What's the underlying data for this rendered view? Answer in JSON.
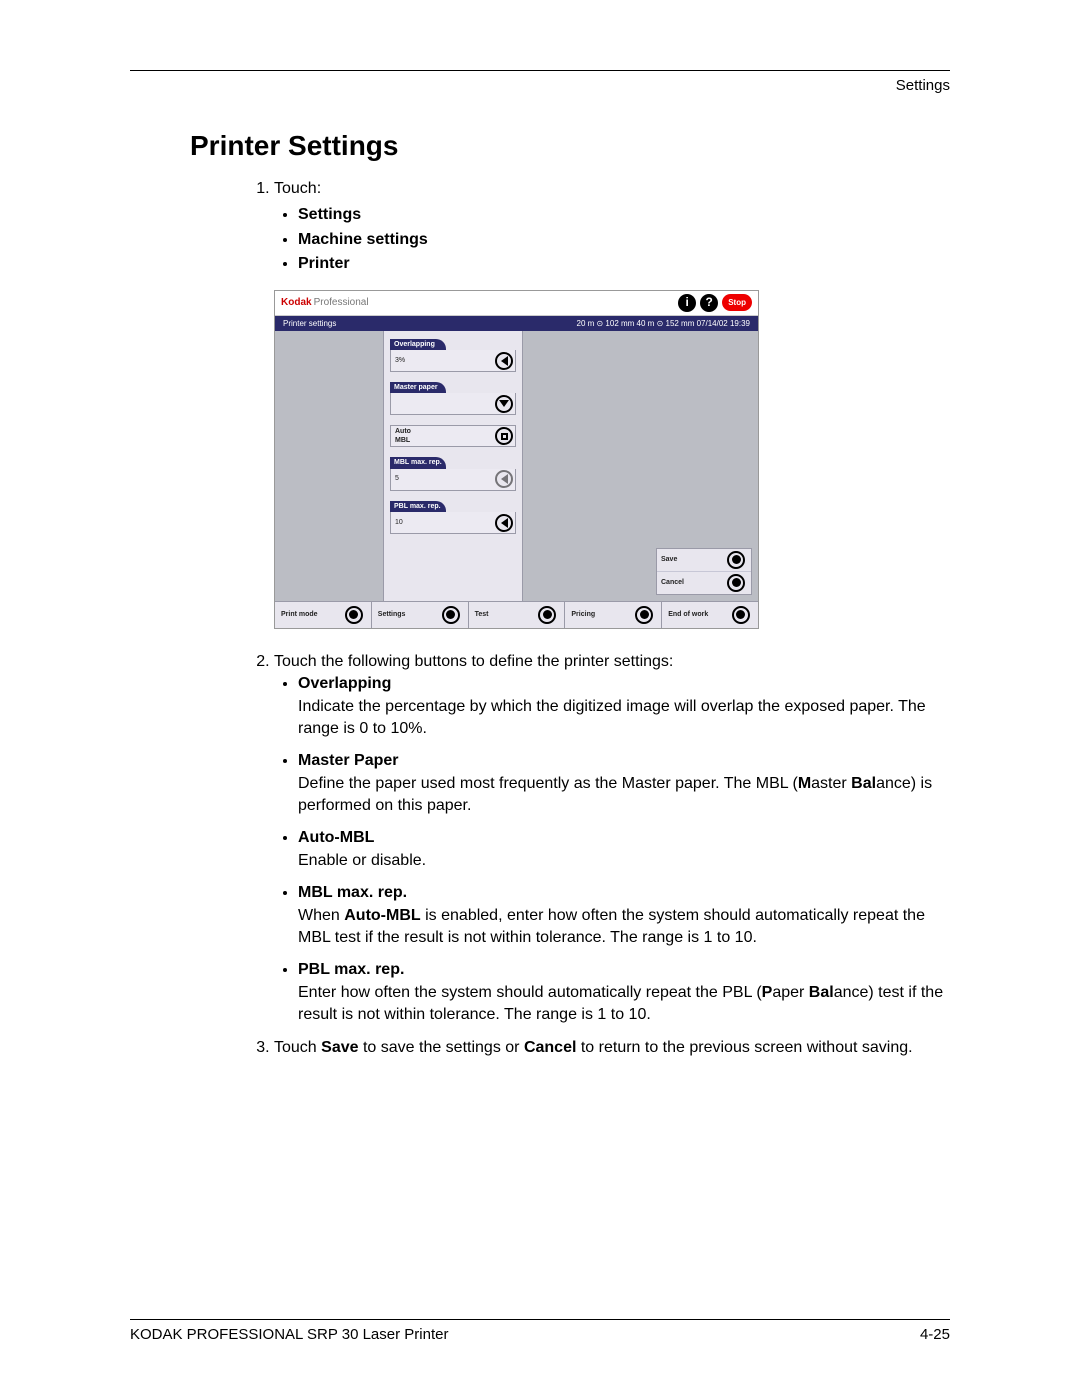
{
  "header": {
    "section": "Settings"
  },
  "title": "Printer Settings",
  "steps": {
    "s1_intro": "Touch:",
    "s1_bullets": [
      "Settings",
      "Machine settings",
      "Printer"
    ],
    "s2_intro": "Touch the following buttons to define the printer settings:",
    "s3_text_a": "Touch ",
    "s3_save": "Save",
    "s3_text_b": " to save the settings or ",
    "s3_cancel": "Cancel",
    "s3_text_c": " to return to the previous screen without saving."
  },
  "ui": {
    "brand_a": "Kodak",
    "brand_b": "Professional",
    "stop": "Stop",
    "subbar_left": "Printer settings",
    "subbar_right": "20 m ⊙ 102 mm   40 m ⊙ 152 mm  07/14/02    19:39",
    "params": {
      "overlapping_label": "Overlapping",
      "overlapping_value": "3%",
      "master_label": "Master paper",
      "master_value": "",
      "auto_label": "Auto\nMBL",
      "mbl_label": "MBL max. rep.",
      "mbl_value": "5",
      "pbl_label": "PBL max. rep.",
      "pbl_value": "10"
    },
    "save": "Save",
    "cancel": "Cancel",
    "footer": {
      "a": "Print mode",
      "b": "Settings",
      "c": "Test",
      "d": "Pricing",
      "e": "End of work"
    }
  },
  "defs": {
    "overlapping_t": "Overlapping",
    "overlapping_b": "Indicate the percentage by which the digitized image will overlap the exposed paper. The range is 0 to 10%.",
    "master_t": "Master Paper",
    "master_b_a": "Define the paper used most frequently as the Master paper. The MBL (",
    "master_b_m": "M",
    "master_b_b": "aster ",
    "master_b_bal_b": "B",
    "master_b_bal": "al",
    "master_b_c": "ance) is performed on this paper.",
    "auto_t": "Auto-MBL",
    "auto_b": "Enable or disable.",
    "mbl_t": "MBL max. rep.",
    "mbl_b_a": "When ",
    "mbl_b_bold": "Auto-MBL",
    "mbl_b_b": " is enabled, enter how often the system should automatically repeat the MBL test if the result is not within tolerance. The range is 1 to 10.",
    "pbl_t": "PBL max. rep.",
    "pbl_b_a": "Enter how often the system should automatically repeat the PBL (",
    "pbl_b_p": "P",
    "pbl_b_aper": "aper ",
    "pbl_b_bal_b": "B",
    "pbl_b_bal": "al",
    "pbl_b_b": "ance) test if the result is not within tolerance. The range is 1 to 10."
  },
  "footer": {
    "left": "KODAK PROFESSIONAL SRP 30 Laser Printer",
    "right": "4-25"
  }
}
